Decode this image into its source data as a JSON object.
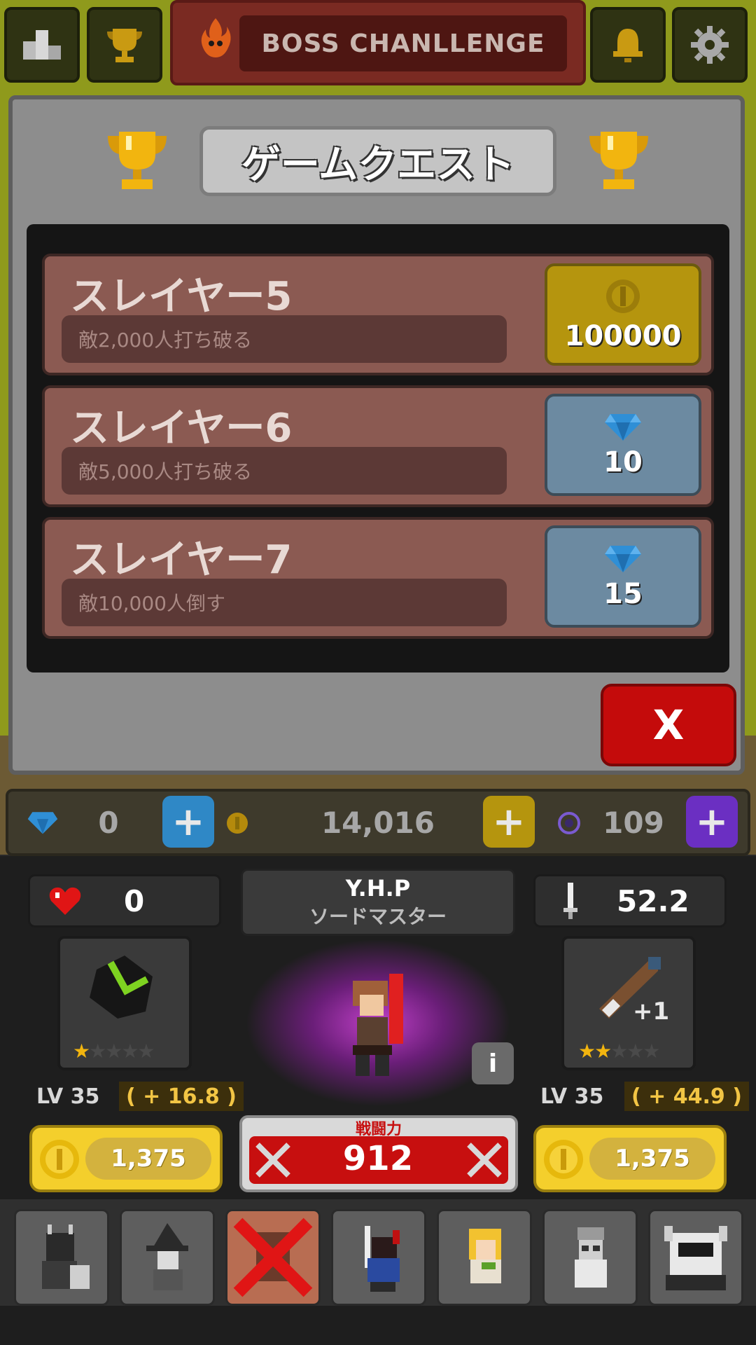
{
  "top_bar": {
    "boss_label": "BOSS CHANLLENGE",
    "buttons": [
      "ranking-icon",
      "trophy-icon",
      "bell-icon",
      "gear-icon"
    ]
  },
  "quest_panel": {
    "title": "ゲームクエスト",
    "quests": [
      {
        "title": "スレイヤー5",
        "desc": "敵2,000人打ち破る",
        "reward_type": "gold",
        "reward": "100000"
      },
      {
        "title": "スレイヤー6",
        "desc": "敵5,000人打ち破る",
        "reward_type": "gem",
        "reward": "10"
      },
      {
        "title": "スレイヤー7",
        "desc": "敵10,000人倒す",
        "reward_type": "gem",
        "reward": "15"
      }
    ],
    "close_label": "X"
  },
  "currency": {
    "gems": "0",
    "gold": "14,016",
    "souls": "109",
    "plus": "+"
  },
  "stats": {
    "hearts": "0",
    "player_name": "Y.H.P",
    "player_class": "ソードマスター",
    "attack": "52.2",
    "info": "i"
  },
  "equipment": {
    "left": {
      "stars_filled": "★",
      "stars_empty": "★★★★",
      "level": "LV 35",
      "bonus": "( + 16.8 )",
      "cost": "1,375"
    },
    "right": {
      "stars_filled": "★★",
      "stars_empty": "★★★",
      "plus": "+1",
      "level": "LV 35",
      "bonus": "( + 44.9 )",
      "cost": "1,375"
    }
  },
  "power": {
    "label": "戦闘力",
    "value": "912"
  },
  "colors": {
    "gold": "#f4cf2c",
    "gem": "#2f8fd6",
    "soul": "#6b2fc2",
    "accent_red": "#c70f0f"
  }
}
